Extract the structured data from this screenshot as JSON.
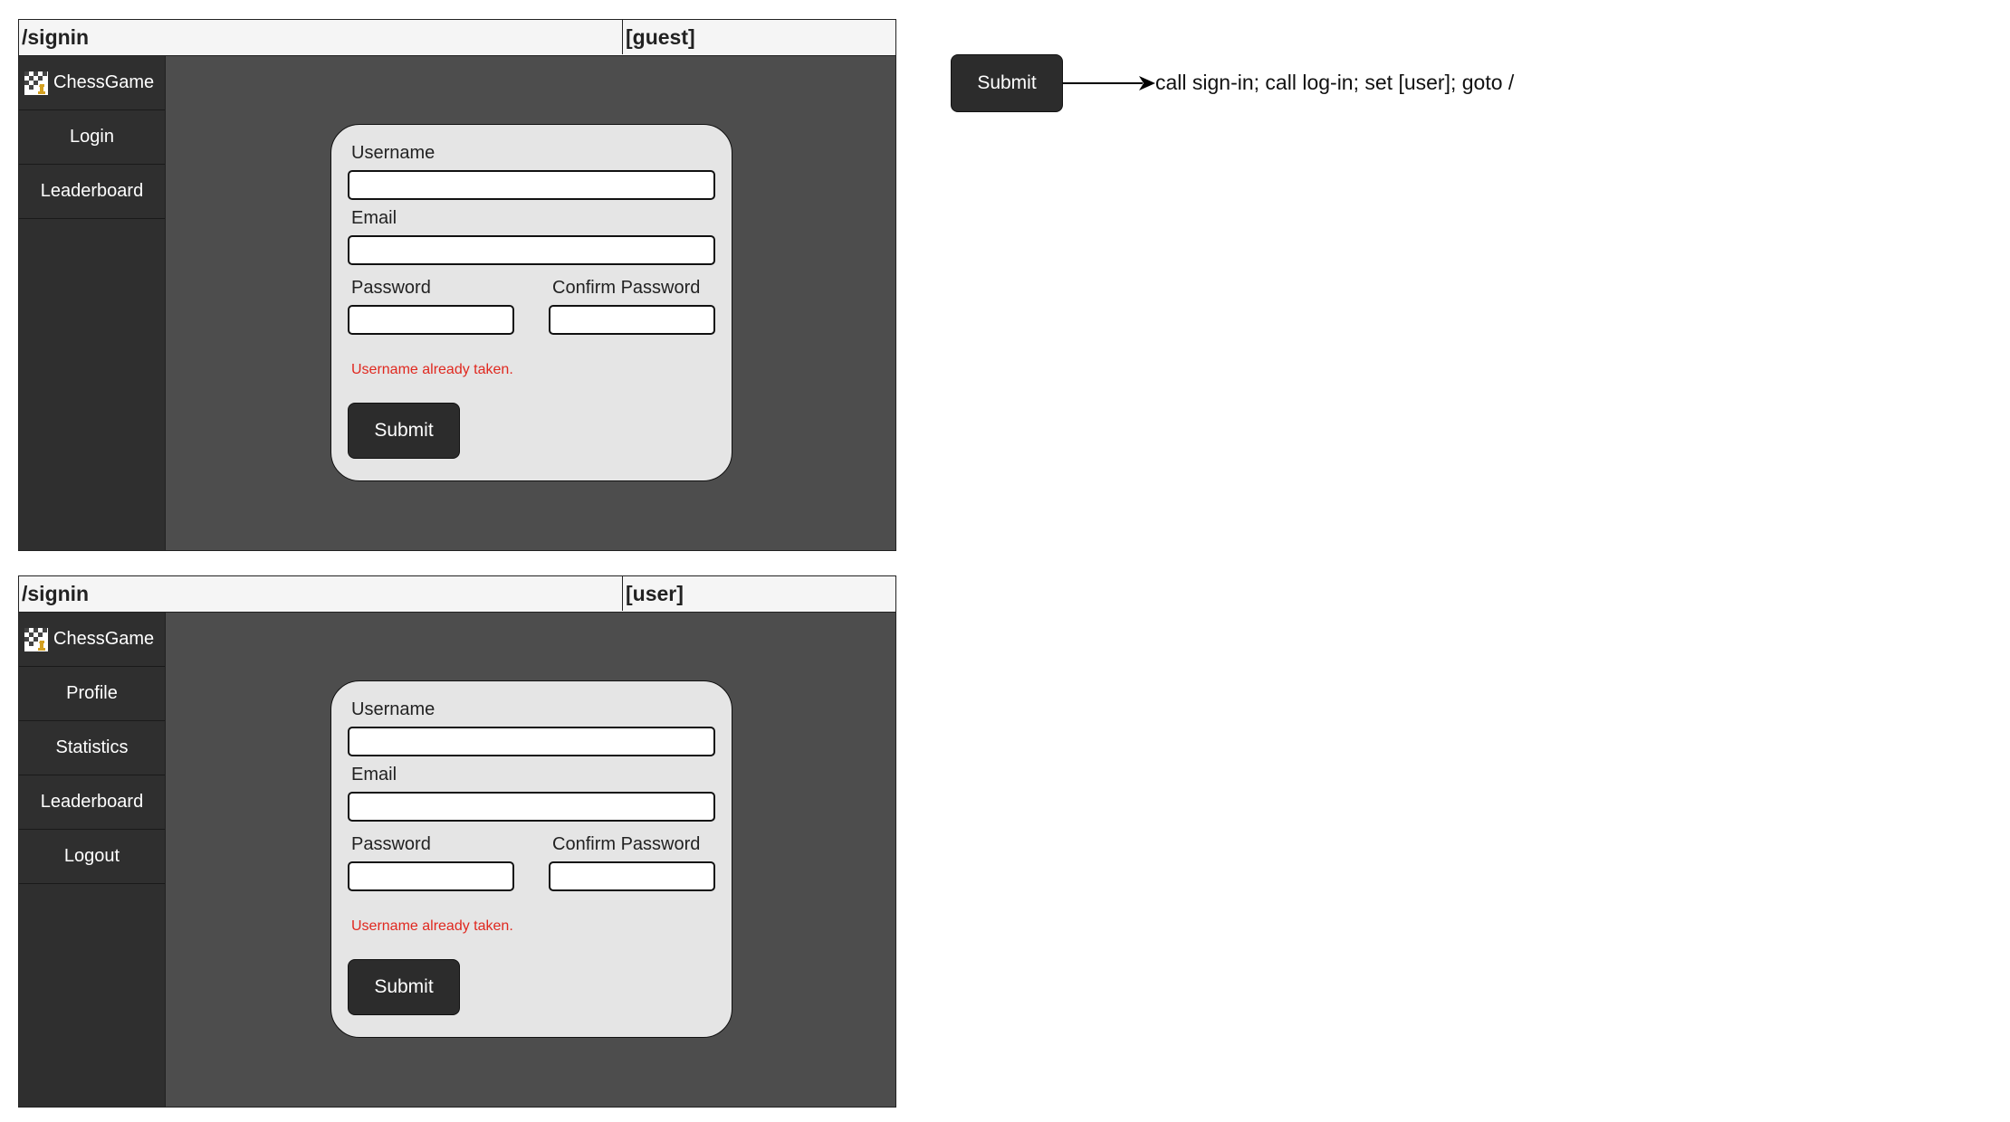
{
  "screens": [
    {
      "route": "/signin",
      "role": "[guest]",
      "brand": "ChessGame",
      "nav": [
        "Login",
        "Leaderboard"
      ],
      "form": {
        "username_label": "Username",
        "email_label": "Email",
        "password_label": "Password",
        "confirm_label": "Confirm Password",
        "error": "Username already taken.",
        "submit": "Submit"
      }
    },
    {
      "route": "/signin",
      "role": "[user]",
      "brand": "ChessGame",
      "nav": [
        "Profile",
        "Statistics",
        "Leaderboard",
        "Logout"
      ],
      "form": {
        "username_label": "Username",
        "email_label": "Email",
        "password_label": "Password",
        "confirm_label": "Confirm Password",
        "error": "Username already taken.",
        "submit": "Submit"
      }
    }
  ],
  "legend": {
    "button": "Submit",
    "action": "call sign-in; call log-in; set [user]; goto /"
  },
  "colors": {
    "sidebar": "#2f2f2f",
    "content": "#4d4d4d",
    "card": "#e5e5e5",
    "error": "#e0281f",
    "button": "#2c2c2c"
  }
}
